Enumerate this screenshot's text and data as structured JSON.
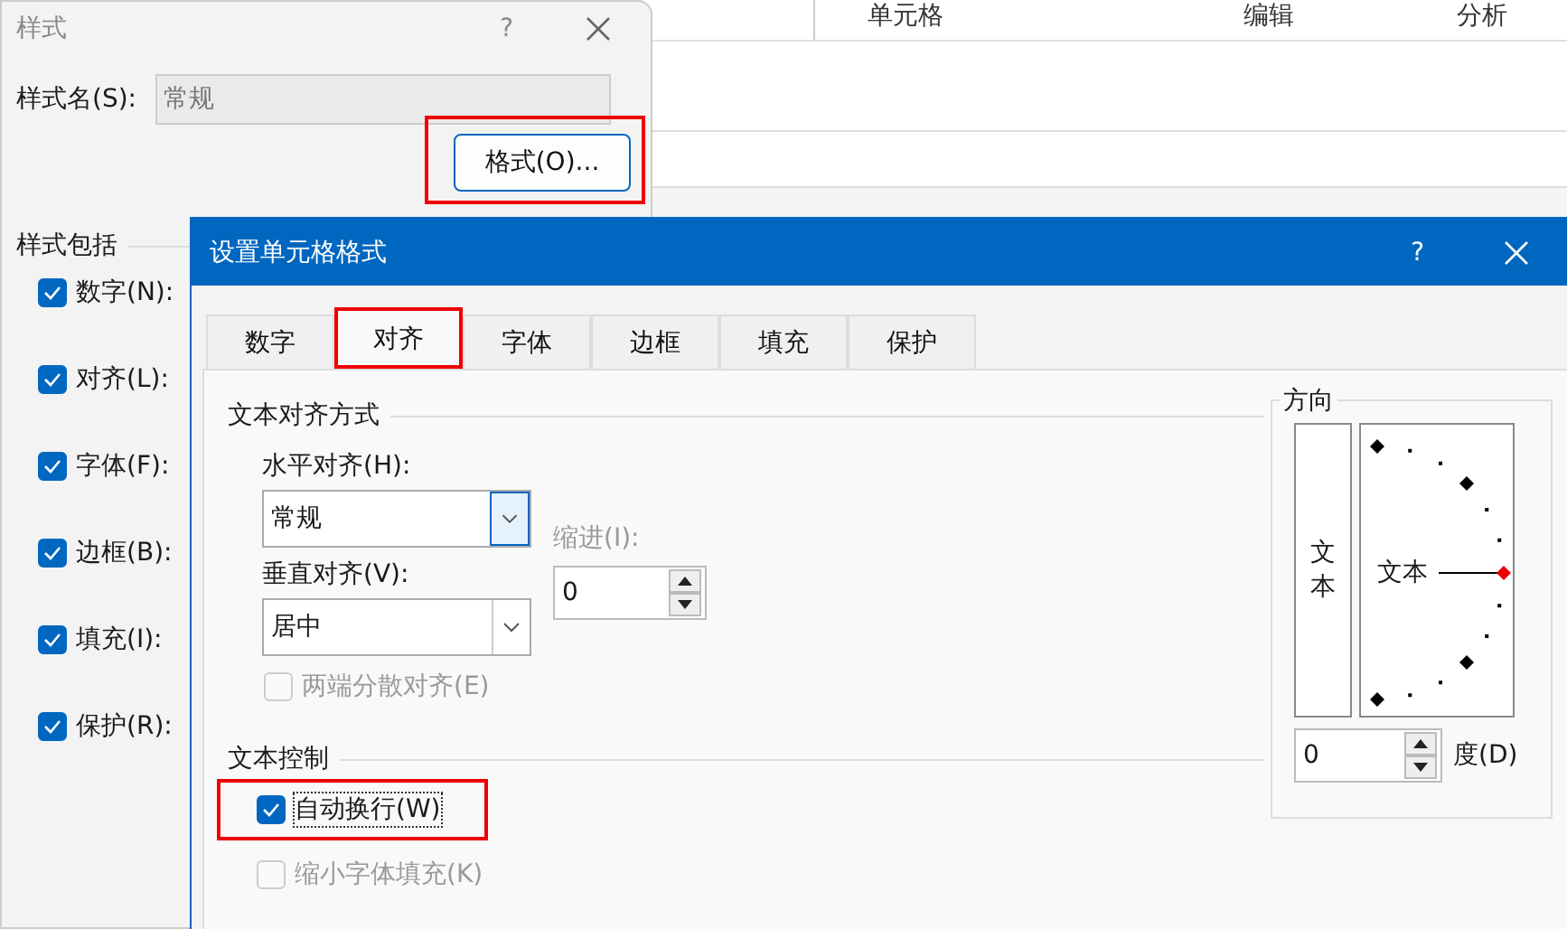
{
  "background_sheet": {
    "ribbon_groups": [
      "单元格",
      "编辑",
      "分析"
    ]
  },
  "style_dialog": {
    "title": "样式",
    "help": "?",
    "style_name_label": "样式名(S):",
    "style_name_value": "常规",
    "format_button": {
      "label": "格式(O)...",
      "highlighted": true
    },
    "includes_label": "样式包括",
    "includes": [
      {
        "label": "数字(N):",
        "checked": true
      },
      {
        "label": "对齐(L):",
        "checked": true
      },
      {
        "label": "字体(F):",
        "checked": true
      },
      {
        "label": "边框(B):",
        "checked": true
      },
      {
        "label": "填充(I):",
        "checked": true
      },
      {
        "label": "保护(R):",
        "checked": true
      }
    ]
  },
  "format_dialog": {
    "title": "设置单元格格式",
    "help": "?",
    "tabs": [
      {
        "label": "数字",
        "selected": false,
        "highlighted": false
      },
      {
        "label": "对齐",
        "selected": true,
        "highlighted": true
      },
      {
        "label": "字体",
        "selected": false,
        "highlighted": false
      },
      {
        "label": "边框",
        "selected": false,
        "highlighted": false
      },
      {
        "label": "填充",
        "selected": false,
        "highlighted": false
      },
      {
        "label": "保护",
        "selected": false,
        "highlighted": false
      }
    ],
    "alignment": {
      "title": "文本对齐方式",
      "horizontal": {
        "label": "水平对齐(H):",
        "value": "常规",
        "focused": true
      },
      "vertical": {
        "label": "垂直对齐(V):",
        "value": "居中",
        "focused": false
      },
      "indent": {
        "label": "缩进(I):",
        "value": "0",
        "disabled": true
      },
      "distributed": {
        "label": "两端分散对齐(E)",
        "checked": false,
        "disabled": true
      }
    },
    "text_control": {
      "title": "文本控制",
      "options": [
        {
          "label": "自动换行(W)",
          "checked": true,
          "disabled": false,
          "highlighted": true
        },
        {
          "label": "缩小字体填充(K)",
          "checked": false,
          "disabled": true,
          "highlighted": false
        }
      ]
    },
    "orientation": {
      "title": "方向",
      "vertical_text": "文本",
      "dial_text": "文本",
      "degrees_value": "0",
      "degrees_label": "度(D)"
    }
  }
}
